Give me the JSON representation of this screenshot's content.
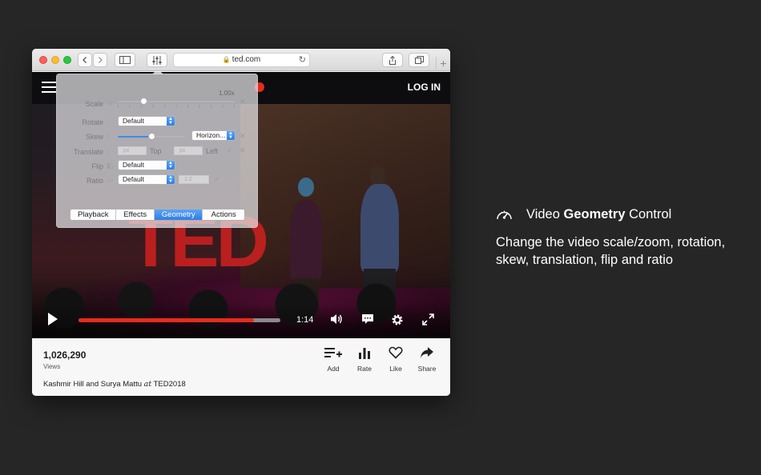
{
  "browser": {
    "url": "ted.com"
  },
  "site": {
    "login_label": "LOG IN",
    "logo_text": "TED"
  },
  "player": {
    "time": "1:14",
    "progress": 0.87
  },
  "panel": {
    "scale": {
      "label": "Scale",
      "value": "1.00x",
      "position": 0.22
    },
    "rotate": {
      "label": "Rotate",
      "value": "Default"
    },
    "skew": {
      "label": "Skew",
      "value": "Horizon...",
      "position": 0.5
    },
    "translate": {
      "label": "Translate",
      "x_placeholder": "px",
      "x_suffix": "Top",
      "y_placeholder": "px",
      "y_suffix": "Left"
    },
    "flip": {
      "label": "Flip",
      "value": "Default"
    },
    "ratio": {
      "label": "Ratio",
      "value": "Default",
      "custom_placeholder": "1:2"
    },
    "tabs": [
      "Playback",
      "Effects",
      "Geometry",
      "Actions"
    ],
    "active_tab": "Geometry"
  },
  "talk": {
    "views_count": "1,026,290",
    "views_label": "Views",
    "speakers": "Kashmir Hill and Surya Mattu",
    "at": "at",
    "event": "TED2018",
    "actions": [
      "Add",
      "Rate",
      "Like",
      "Share"
    ]
  },
  "feature": {
    "title_prefix": "Video",
    "title_bold": "Geometry",
    "title_suffix": "Control",
    "description": "Change the video scale/zoom, rotation, skew, translation, flip and ratio"
  },
  "colors": {
    "accent": "#e62b1e",
    "selection_blue": "#3d8de8",
    "background": "#262626"
  }
}
